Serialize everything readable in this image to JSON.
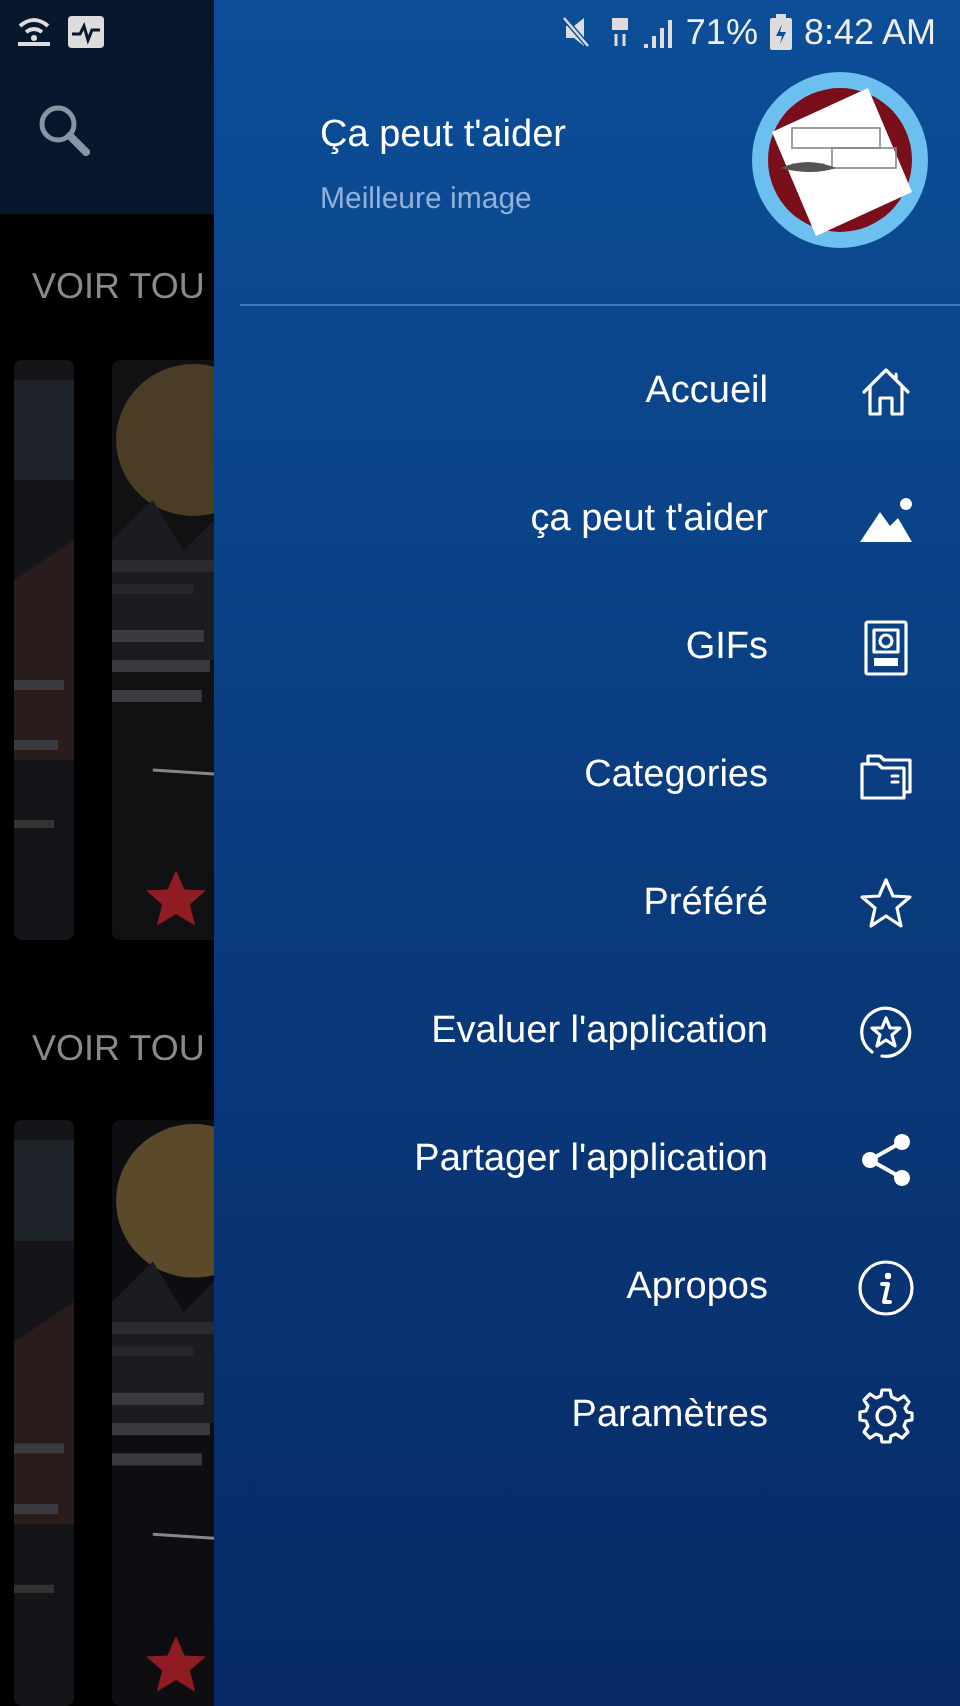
{
  "status_bar": {
    "battery": "71%",
    "time": "8:42 AM"
  },
  "background": {
    "sections": [
      {
        "heading": "VOIR TOU"
      },
      {
        "heading": "VOIR TOU"
      }
    ]
  },
  "drawer": {
    "title": "Ça peut t'aider",
    "subtitle": "Meilleure image",
    "items": [
      {
        "label": "Accueil"
      },
      {
        "label": "ça peut t'aider"
      },
      {
        "label": "GIFs"
      },
      {
        "label": "Categories"
      },
      {
        "label": "Préféré"
      },
      {
        "label": "Evaluer l'application"
      },
      {
        "label": "Partager l'application"
      },
      {
        "label": "Apropos"
      },
      {
        "label": "Paramètres"
      }
    ]
  }
}
